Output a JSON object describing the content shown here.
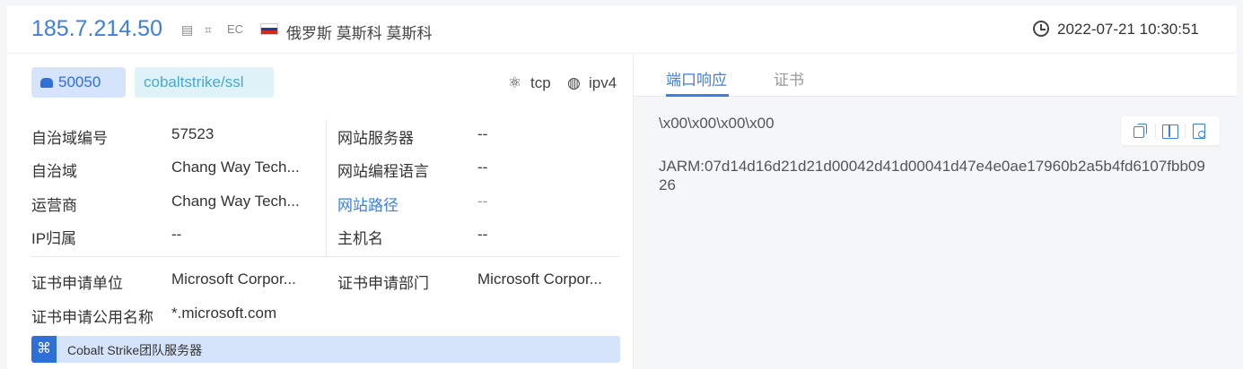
{
  "header": {
    "ip": "185.7.214.50",
    "icons": [
      "document-icon",
      "crop-icon",
      "ec-icon"
    ],
    "ec_label": "EC",
    "location": "俄罗斯 莫斯科 莫斯科",
    "timestamp": "2022-07-21 10:30:51",
    "flag_colors": [
      "#ffffff",
      "#1c3f9e",
      "#d52b1e"
    ]
  },
  "tags": {
    "port": "50050",
    "service": "cobaltstrike/ssl",
    "protocol": "tcp",
    "ip_version": "ipv4"
  },
  "info_left": [
    {
      "label": "自治域编号",
      "value": "57523"
    },
    {
      "label": "自治域",
      "value": "Chang Way Tech..."
    },
    {
      "label": "运营商",
      "value": "Chang Way Tech..."
    },
    {
      "label": "IP归属",
      "value": "--"
    }
  ],
  "info_right": [
    {
      "label": "网站服务器",
      "value": "--"
    },
    {
      "label": "网站编程语言",
      "value": "--"
    },
    {
      "label": "网站路径",
      "value": "--"
    },
    {
      "label": "主机名",
      "value": "--"
    }
  ],
  "cert": {
    "org_label": "证书申请单位",
    "org_value": "Microsoft Corpor...",
    "dept_label": "证书申请部门",
    "dept_value": "Microsoft Corpor...",
    "cn_label": "证书申请公用名称",
    "cn_value": "*.microsoft.com"
  },
  "banner": {
    "icon": "⌘",
    "text": "Cobalt Strike团队服务器"
  },
  "right_panel": {
    "tabs": [
      "端口响应",
      "证书"
    ],
    "active_tab": "端口响应",
    "response": "\\x00\\x00\\x00\\x00",
    "jarm": "JARM:07d14d16d21d21d00042d41d00041d47e4e0ae17960b2a5b4fd6107fbb0926"
  },
  "colors": {
    "accent": "#3d7fe0",
    "tag_port_bg": "#d6e4fb",
    "tag_service_bg": "#dff2f8"
  }
}
